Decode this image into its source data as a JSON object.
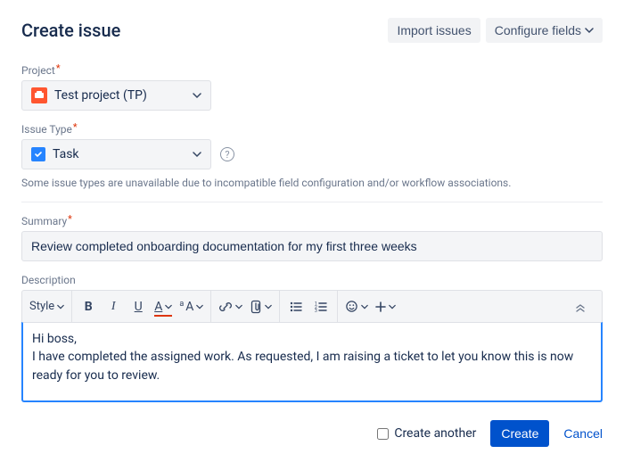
{
  "header": {
    "title": "Create issue",
    "import_label": "Import issues",
    "configure_label": "Configure fields"
  },
  "project": {
    "label": "Project",
    "value": "Test project (TP)"
  },
  "issue_type": {
    "label": "Issue Type",
    "value": "Task",
    "hint": "Some issue types are unavailable due to incompatible field configuration and/or workflow associations."
  },
  "summary": {
    "label": "Summary",
    "value": "Review completed onboarding documentation for my first three weeks"
  },
  "description": {
    "label": "Description",
    "style_label": "Style",
    "body": "Hi boss,\nI have completed the assigned work. As requested, I am raising a ticket to let you know this is now ready for you to review."
  },
  "footer": {
    "create_another_label": "Create another",
    "create_label": "Create",
    "cancel_label": "Cancel"
  }
}
